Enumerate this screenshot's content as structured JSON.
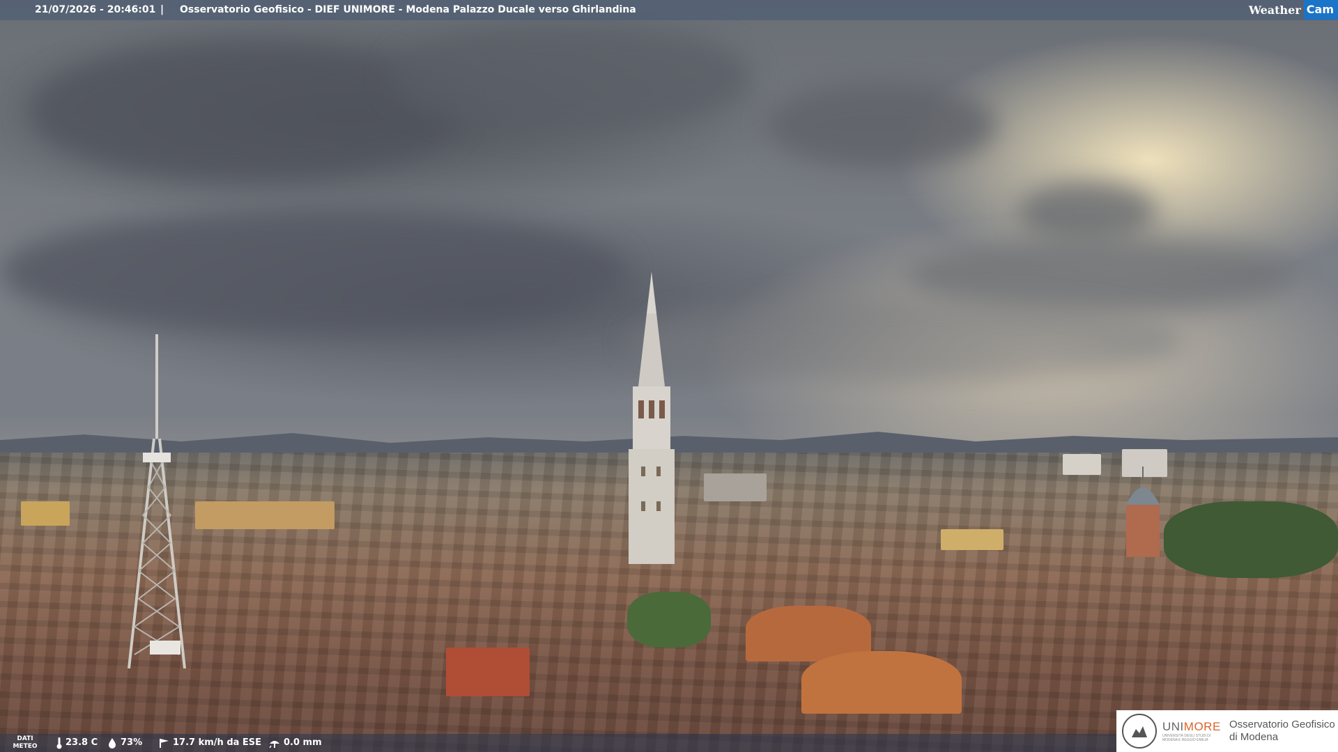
{
  "overlay": {
    "datetime": "21/07/2026 - 20:46:01",
    "separator": "|",
    "title": "Osservatorio Geofisico - DIEF UNIMORE - Modena Palazzo Ducale verso Ghirlandina"
  },
  "brand": {
    "weather": "Weather",
    "cam": "Cam"
  },
  "weather_data": {
    "label": "DATI METEO",
    "temperature": "23.8 C",
    "humidity": "73%",
    "wind": "17.7 km/h da ESE",
    "rain": "0.0 mm"
  },
  "icons": {
    "temperature": "thermometer-icon",
    "humidity": "droplet-icon",
    "wind": "wind-icon",
    "rain": "rain-gauge-icon"
  },
  "logo": {
    "uni_prefix": "UNI",
    "uni_suffix": "MORE",
    "uni_sub": "UNIVERSITÀ DEGLI STUDI DI MODENA E REGGIO EMILIA",
    "observatory_line1": "Osservatorio Geofisico",
    "observatory_line2": "di Modena"
  },
  "colors": {
    "accent_orange": "#d9632a",
    "cam_blue": "#1a74c8"
  }
}
